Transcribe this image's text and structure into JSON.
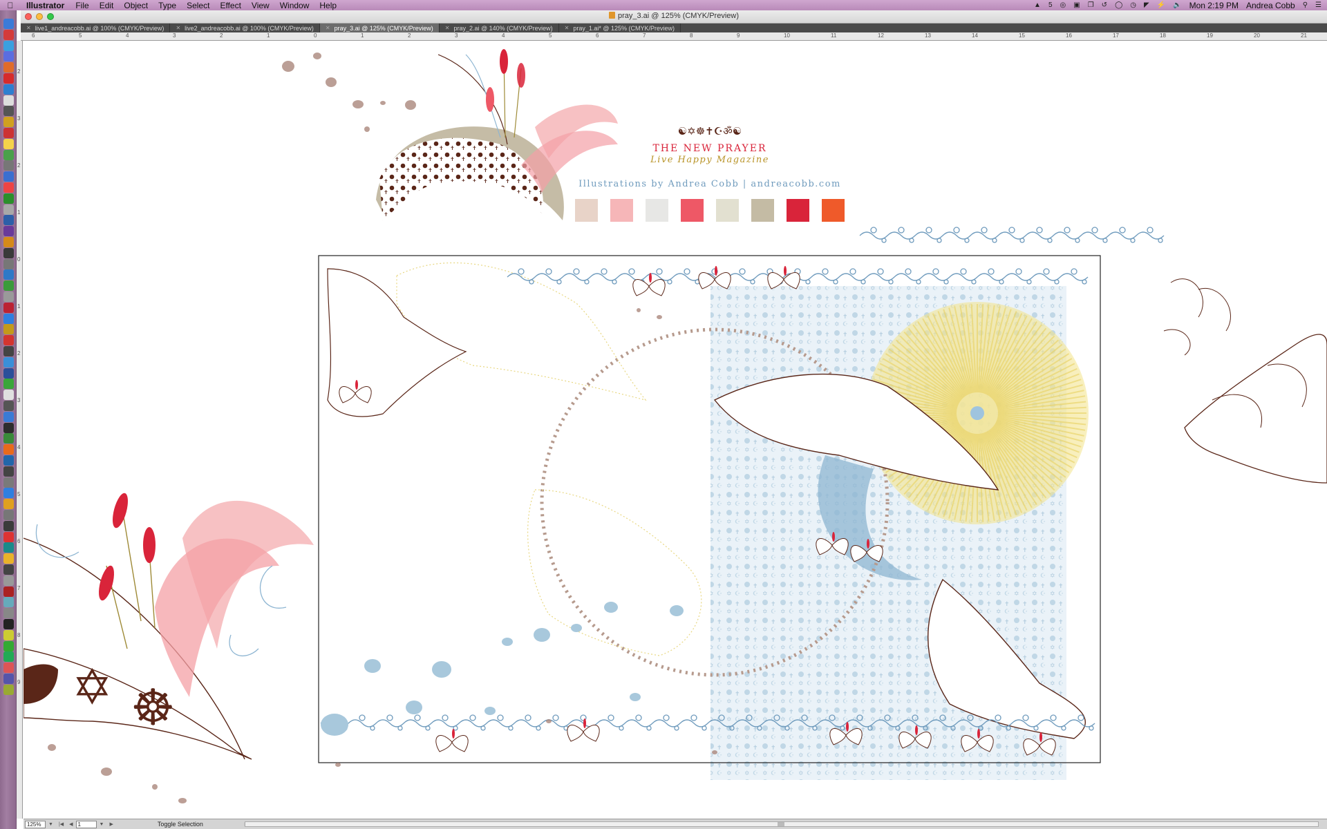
{
  "menubar": {
    "app_name": "Illustrator",
    "items": [
      "File",
      "Edit",
      "Object",
      "Type",
      "Select",
      "Effect",
      "View",
      "Window",
      "Help"
    ],
    "status_number": "5",
    "clock": "Mon 2:19 PM",
    "user": "Andrea Cobb"
  },
  "window": {
    "title": "pray_3.ai @ 125% (CMYK/Preview)"
  },
  "tabs": [
    {
      "label": "live1_andreacobb.ai @ 100% (CMYK/Preview)",
      "active": false
    },
    {
      "label": "live2_andreacobb.ai @ 100% (CMYK/Preview)",
      "active": false
    },
    {
      "label": "pray_3.ai @ 125% (CMYK/Preview)",
      "active": true
    },
    {
      "label": "pray_2.ai @ 140% (CMYK/Preview)",
      "active": false
    },
    {
      "label": "pray_1.ai* @ 125% (CMYK/Preview)",
      "active": false
    }
  ],
  "artwork": {
    "title": "THE NEW PRAYER",
    "subtitle": "Live Happy Magazine",
    "credit": "Illustrations by Andrea Cobb | andreacobb.com",
    "symbols": "☯✡☸✝☪ॐ☯",
    "swatches": [
      "#e8d3c8",
      "#f6b6b8",
      "#e7e7e5",
      "#ee5866",
      "#e2e0d0",
      "#c4bba4",
      "#d9243a",
      "#ef5a2a"
    ]
  },
  "rulers": {
    "h_labels": [
      "6",
      "5",
      "4",
      "3",
      "2",
      "1",
      "0",
      "1",
      "2",
      "3",
      "4",
      "5",
      "6",
      "7",
      "8",
      "9",
      "10",
      "11",
      "12",
      "13",
      "14",
      "15",
      "16",
      "17",
      "18",
      "19",
      "20",
      "21"
    ],
    "v_labels": [
      "2",
      "3",
      "2",
      "1",
      "0",
      "1",
      "2",
      "3",
      "4",
      "5",
      "6",
      "7",
      "8",
      "9"
    ]
  },
  "statusbar": {
    "zoom": "125%",
    "page": "1",
    "status_text": "Toggle Selection"
  }
}
